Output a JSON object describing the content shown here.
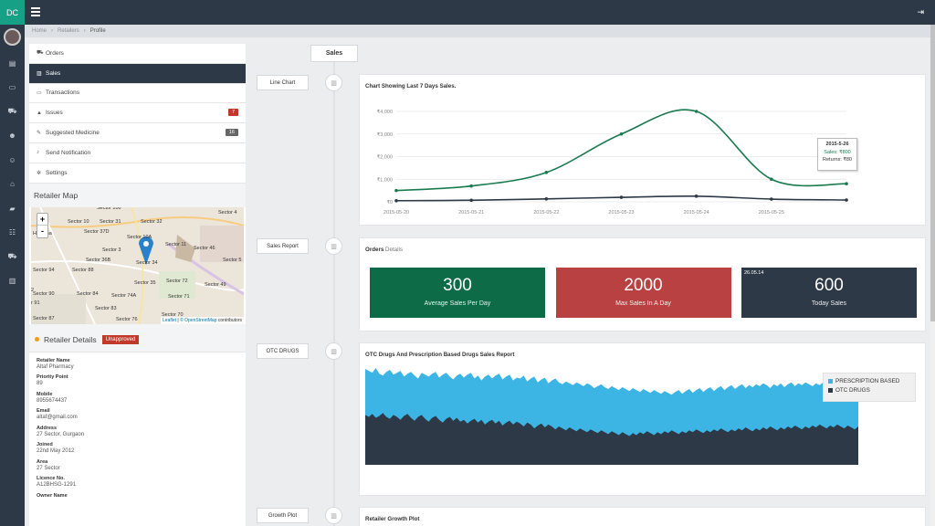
{
  "brand": "DC",
  "breadcrumb": [
    "Home",
    "Retailers",
    "Profile"
  ],
  "sidebar_icons": [
    "file-icon",
    "monitor-icon",
    "cart-icon",
    "users-icon",
    "user-icon",
    "home-icon",
    "truck-icon",
    "group-icon",
    "cart-icon",
    "chart-icon"
  ],
  "nav": [
    {
      "label": "Orders",
      "icon": "cart-icon",
      "active": false
    },
    {
      "label": "Sales",
      "icon": "bar-chart-icon",
      "active": true
    },
    {
      "label": "Transactions",
      "icon": "money-icon",
      "active": false
    },
    {
      "label": "Issues",
      "icon": "warning-icon",
      "active": false,
      "badge": "7",
      "badge_color": "#c0392b"
    },
    {
      "label": "Suggested Medicine",
      "icon": "edit-icon",
      "active": false,
      "badge": "16",
      "badge_color": "#666666"
    },
    {
      "label": "Send Notification",
      "icon": "bell-icon",
      "active": false
    },
    {
      "label": "Settings",
      "icon": "cogs-icon",
      "active": false
    }
  ],
  "map": {
    "title": "Retailer Map",
    "zoom_in": "+",
    "zoom_out": "-",
    "labels": [
      "Sector 10",
      "Sector 31",
      "Sector 37D",
      "Sector 10A",
      "Sector 32",
      "Haryana",
      "Sector 11",
      "Sector 46",
      "Sector 3",
      "Sector 36B",
      "Sector 34",
      "Sector 5",
      "Sector 94",
      "Sector 88",
      "Sector 72",
      "Sector 35",
      "Sector 49",
      "Sector 90",
      "Sector 84",
      "Sector 74A",
      "Sector 71",
      "Sector 83",
      "Sector 70",
      "Sector 87",
      "Sector 76",
      "Sector 4",
      "Sector 100",
      "2",
      "or 91"
    ],
    "attribution_leaflet": "Leaflet",
    "attribution_osm": "© OpenStreetMap",
    "attribution_rest": "contributors"
  },
  "retailer": {
    "title": "Retailer Details",
    "status": "Unapproved",
    "fields": [
      {
        "label": "Retailer Name",
        "value": "Altaf Pharmacy"
      },
      {
        "label": "Priority Point",
        "value": "89"
      },
      {
        "label": "Mobile",
        "value": "8955674437"
      },
      {
        "label": "Email",
        "value": "altaf@gmail.com"
      },
      {
        "label": "Address",
        "value": "27 Sector, Gurgaon"
      },
      {
        "label": "Joined",
        "value": "22nd May 2012"
      },
      {
        "label": "Area",
        "value": "27 Sector"
      },
      {
        "label": "Licence No.",
        "value": "A12BHSG-1291"
      },
      {
        "label": "Owner Name",
        "value": ""
      }
    ]
  },
  "timeline": {
    "top_tab": "Sales",
    "labels": [
      "Line Chart",
      "Sales Report",
      "OTC DRUGS",
      "Growth Plot"
    ]
  },
  "line_card": {
    "title": "Chart Showing Last 7 Days Sales.",
    "tooltip": {
      "date": "2015-5-26",
      "sales": "Sales: ₹800",
      "returns": "Returns: ₹80"
    }
  },
  "orders_card": {
    "title": "Orders",
    "subtitle": "Details",
    "tiles": [
      {
        "value": "300",
        "label": "Average Sales Per Day",
        "color": "#0e6b48"
      },
      {
        "value": "2000",
        "label": "Max Sales In A Day",
        "color": "#b94141"
      },
      {
        "value": "600",
        "label": "Today Sales",
        "color": "#2d3947",
        "date": "26.05.14"
      }
    ]
  },
  "otc_card": {
    "title": "OTC Drugs And Prescription Based Drugs Sales Report",
    "legend": [
      {
        "label": "PRESCRIPTION BASED",
        "color": "#3cb5e5"
      },
      {
        "label": "OTC DRUGS",
        "color": "#2d3947"
      }
    ]
  },
  "growth_card": {
    "title": "Retailer Growth Plot"
  },
  "chart_data": [
    {
      "type": "line",
      "title": "Chart Showing Last 7 Days Sales.",
      "x": [
        "2015-05-20",
        "2015-05-21",
        "2015-05-22",
        "2015-05-23",
        "2015-05-24",
        "2015-05-25",
        "2015-05-26"
      ],
      "x_ticks": [
        "2015-05-20",
        "2015-05-21",
        "2015-05-22",
        "2015-05-23",
        "2015-05-24",
        "2015-05-25"
      ],
      "y_ticks": [
        "₹0",
        "₹1,000",
        "₹2,000",
        "₹3,000",
        "₹4,000"
      ],
      "ylim": [
        0,
        4000
      ],
      "series": [
        {
          "name": "Sales",
          "values": [
            500,
            700,
            1300,
            3000,
            4000,
            1000,
            800
          ],
          "color": "#1a7a4f"
        },
        {
          "name": "Returns",
          "values": [
            50,
            70,
            130,
            200,
            250,
            120,
            80
          ],
          "color": "#2d3947"
        }
      ],
      "grid": true
    },
    {
      "type": "area",
      "title": "OTC Drugs And Prescription Based Drugs Sales Report",
      "series": [
        {
          "name": "PRESCRIPTION BASED",
          "color": "#3cb5e5",
          "values": [
            100,
            98,
            96,
            101,
            95,
            93,
            97,
            99,
            94,
            96,
            98,
            92,
            95,
            97,
            93,
            90,
            96,
            94,
            92,
            95,
            97,
            91,
            94,
            96,
            92,
            89,
            93,
            95,
            91,
            94,
            96,
            90,
            93,
            88,
            92,
            94,
            90,
            93,
            95,
            89,
            92,
            94,
            88,
            91,
            90,
            93,
            87,
            90,
            92,
            86,
            89,
            91,
            85,
            88,
            90,
            86,
            84,
            87,
            85,
            83,
            86,
            84,
            82,
            85,
            83,
            80,
            82,
            84,
            81,
            79,
            82,
            80,
            78,
            81,
            79,
            77,
            80,
            78,
            76,
            79,
            77,
            75,
            78,
            76,
            74,
            77,
            75,
            73,
            76,
            78,
            74,
            77,
            79,
            75,
            78,
            80,
            76,
            79,
            81,
            77,
            80,
            82,
            78,
            81,
            83,
            79,
            82,
            84,
            80,
            83,
            81,
            84,
            82,
            85,
            83,
            80,
            84,
            82,
            85,
            81,
            84,
            86,
            82,
            85,
            83,
            86,
            84,
            82,
            85,
            83,
            86,
            84,
            82,
            80,
            83,
            81,
            84,
            82,
            80,
            78,
            81
          ]
        },
        {
          "name": "OTC DRUGS",
          "color": "#2d3947",
          "values": [
            52,
            50,
            53,
            49,
            51,
            54,
            50,
            48,
            52,
            50,
            47,
            51,
            53,
            49,
            46,
            50,
            52,
            48,
            45,
            49,
            51,
            47,
            44,
            48,
            50,
            46,
            49,
            45,
            47,
            43,
            46,
            48,
            44,
            47,
            42,
            45,
            47,
            43,
            46,
            41,
            44,
            46,
            42,
            45,
            43,
            40,
            44,
            42,
            38,
            41,
            43,
            39,
            42,
            40,
            37,
            40,
            38,
            36,
            39,
            37,
            35,
            38,
            36,
            34,
            37,
            35,
            33,
            36,
            34,
            32,
            35,
            33,
            31,
            34,
            32,
            30,
            33,
            31,
            34,
            32,
            35,
            33,
            31,
            34,
            32,
            35,
            33,
            36,
            34,
            32,
            35,
            33,
            36,
            34,
            37,
            35,
            33,
            36,
            34,
            37,
            35,
            38,
            36,
            34,
            37,
            35,
            38,
            36,
            39,
            37,
            35,
            38,
            36,
            39,
            37,
            40,
            38,
            36,
            39,
            37,
            40,
            38,
            41,
            39,
            37,
            40,
            38,
            41,
            39,
            42,
            40,
            38,
            41,
            39,
            42,
            40,
            38,
            41,
            39,
            37,
            40
          ]
        }
      ],
      "ylim": [
        0,
        100
      ]
    }
  ]
}
